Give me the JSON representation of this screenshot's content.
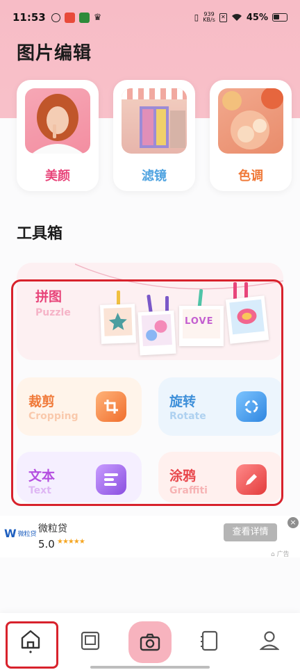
{
  "status_bar": {
    "time": "11:53",
    "net_speed_value": "939",
    "net_speed_unit": "KB/s",
    "battery": "45%"
  },
  "page_title": "图片编辑",
  "features": [
    {
      "label": "美颜",
      "color": "#e8457a"
    },
    {
      "label": "滤镜",
      "color": "#4fa3e0"
    },
    {
      "label": "色调",
      "color": "#f07a3a"
    }
  ],
  "section_title": "工具箱",
  "tools": {
    "puzzle": {
      "title": "拼图",
      "subtitle": "Puzzle",
      "color": "#e8457a"
    },
    "crop": {
      "title": "裁剪",
      "subtitle": "Cropping",
      "color": "#f07a3a"
    },
    "rotate": {
      "title": "旋转",
      "subtitle": "Rotate",
      "color": "#3d8fd9"
    },
    "text": {
      "title": "文本",
      "subtitle": "Text",
      "color": "#b44ee0"
    },
    "graffiti": {
      "title": "涂鸦",
      "subtitle": "Graffiti",
      "color": "#e8454a"
    }
  },
  "photo_text": "LOVE",
  "ad": {
    "logo_text": "微粒贷",
    "name": "微粒贷",
    "rating": "5.0",
    "stars": "★★★★★",
    "button": "查看详情",
    "close": "×",
    "tag": "广告"
  },
  "nav": [
    "home",
    "gallery",
    "camera",
    "notebook",
    "profile"
  ]
}
